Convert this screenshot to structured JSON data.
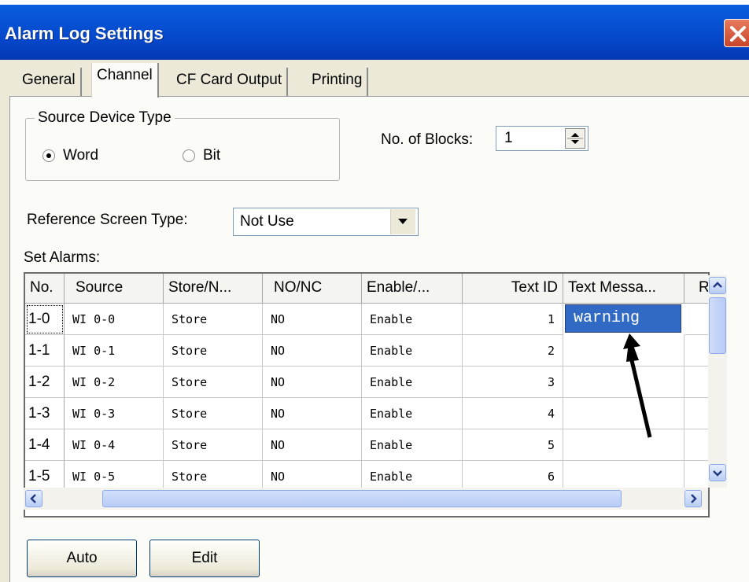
{
  "window": {
    "title": "Alarm Log Settings"
  },
  "tabs": [
    {
      "label": "General",
      "active": false
    },
    {
      "label": "Channel",
      "active": true
    },
    {
      "label": "CF Card Output",
      "active": false
    },
    {
      "label": "Printing",
      "active": false
    }
  ],
  "source_device": {
    "legend": "Source Device Type",
    "options": [
      {
        "label": "Word",
        "selected": true
      },
      {
        "label": "Bit",
        "selected": false
      }
    ]
  },
  "blocks": {
    "label": "No. of Blocks:",
    "value": "1"
  },
  "reference_screen": {
    "label": "Reference Screen Type:",
    "selected": "Not Use"
  },
  "alarms": {
    "label": "Set Alarms:",
    "columns": [
      "No.",
      "Source",
      "Store/N...",
      "NO/NC",
      "Enable/...",
      "Text ID",
      "Text Messa...",
      "R"
    ],
    "rows": [
      {
        "no": "1-0",
        "source": "WI 0-0",
        "store": "Store",
        "nonc": "NO",
        "enable": "Enable",
        "text_id": "1",
        "message": "warning"
      },
      {
        "no": "1-1",
        "source": "WI 0-1",
        "store": "Store",
        "nonc": "NO",
        "enable": "Enable",
        "text_id": "2",
        "message": ""
      },
      {
        "no": "1-2",
        "source": "WI 0-2",
        "store": "Store",
        "nonc": "NO",
        "enable": "Enable",
        "text_id": "3",
        "message": ""
      },
      {
        "no": "1-3",
        "source": "WI 0-3",
        "store": "Store",
        "nonc": "NO",
        "enable": "Enable",
        "text_id": "4",
        "message": ""
      },
      {
        "no": "1-4",
        "source": "WI 0-4",
        "store": "Store",
        "nonc": "NO",
        "enable": "Enable",
        "text_id": "5",
        "message": ""
      },
      {
        "no": "1-5",
        "source": "WI 0-5",
        "store": "Store",
        "nonc": "NO",
        "enable": "Enable",
        "text_id": "6",
        "message": ""
      }
    ]
  },
  "buttons": {
    "auto": "Auto",
    "edit": "Edit"
  },
  "colors": {
    "title_bar": "#0545c8",
    "selection": "#316ac5",
    "panel": "#ece9d8"
  }
}
